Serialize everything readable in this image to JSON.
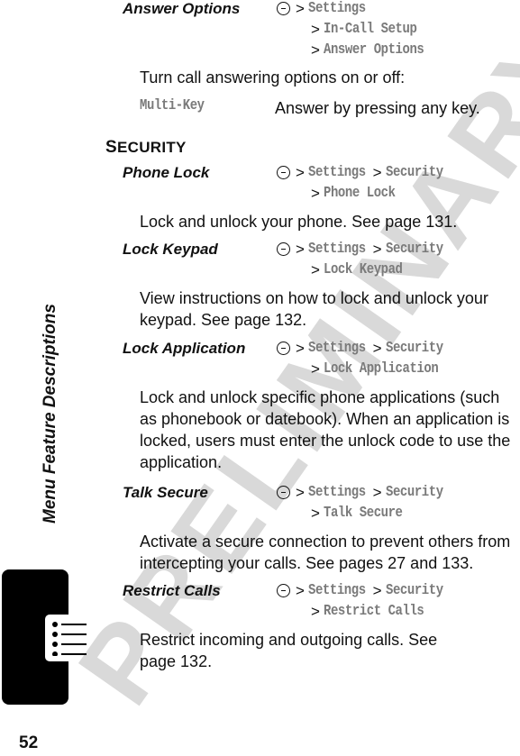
{
  "page": {
    "number": "52",
    "side_title": "Menu Feature Descriptions",
    "watermark": "PRELIMINARY",
    "side_tab_icon": "menu-list-icon"
  },
  "answer_options": {
    "name": "Answer Options",
    "path": [
      "Settings",
      "In-Call Setup",
      "Answer Options"
    ],
    "description": "Turn call answering options on or off:",
    "options": [
      {
        "key": "Multi-Key",
        "text": "Answer by pressing any key."
      }
    ]
  },
  "section": {
    "title_first": "S",
    "title_rest": "ECURITY"
  },
  "features": [
    {
      "name": "Phone Lock",
      "path_line1": [
        "Settings",
        "Security"
      ],
      "path_line2": "Phone Lock",
      "description": [
        "Lock and unlock your phone. See page 131."
      ]
    },
    {
      "name": "Lock Keypad",
      "path_line1": [
        "Settings",
        "Security"
      ],
      "path_line2": "Lock Keypad",
      "description": [
        "View instructions on how to lock and unlock your",
        "keypad. See page 132."
      ]
    },
    {
      "name": "Lock Application",
      "path_line1": [
        "Settings",
        "Security"
      ],
      "path_line2": "Lock Application",
      "description": [
        "Lock and unlock specific phone applications (such",
        "as phonebook or datebook). When an application is",
        "locked, users must enter the unlock code to use the",
        "application."
      ]
    },
    {
      "name": "Talk Secure",
      "path_line1": [
        "Settings",
        "Security"
      ],
      "path_line2": "Talk Secure",
      "description": [
        "Activate a secure connection to prevent others from",
        "intercepting your calls. See pages 27 and 133."
      ]
    },
    {
      "name": "Restrict Calls",
      "path_line1": [
        "Settings",
        "Security"
      ],
      "path_line2": "Restrict Calls",
      "description": [
        "Restrict incoming and outgoing calls. See",
        "page 132."
      ]
    }
  ],
  "symbols": {
    "separator": ">"
  }
}
